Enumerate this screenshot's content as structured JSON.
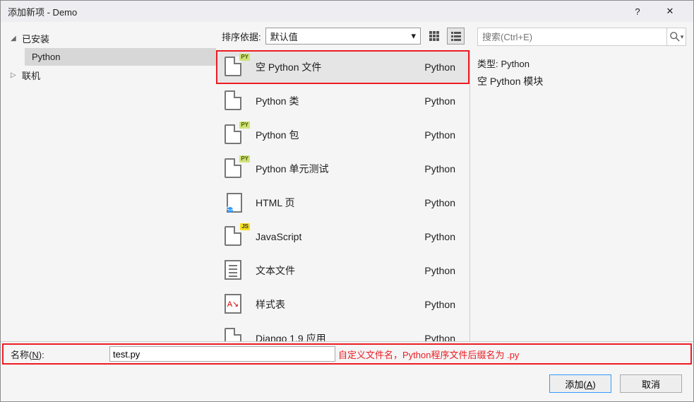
{
  "window": {
    "title": "添加新项 - Demo",
    "help": "?",
    "close": "✕"
  },
  "sidebar": {
    "installed": {
      "label": "已安装",
      "expanded": true,
      "children": [
        {
          "label": "Python",
          "selected": true
        }
      ]
    },
    "online": {
      "label": "联机",
      "expanded": false
    }
  },
  "sort": {
    "label": "排序依据:",
    "value": "默认值"
  },
  "search": {
    "placeholder": "搜索(Ctrl+E)"
  },
  "items": [
    {
      "label": "空 Python 文件",
      "lang": "Python",
      "icon": "py",
      "selected": true
    },
    {
      "label": "Python 类",
      "lang": "Python",
      "icon": "doc"
    },
    {
      "label": "Python 包",
      "lang": "Python",
      "icon": "py"
    },
    {
      "label": "Python 单元测试",
      "lang": "Python",
      "icon": "py"
    },
    {
      "label": "HTML 页",
      "lang": "Python",
      "icon": "html"
    },
    {
      "label": "JavaScript",
      "lang": "Python",
      "icon": "js"
    },
    {
      "label": "文本文件",
      "lang": "Python",
      "icon": "txt"
    },
    {
      "label": "样式表",
      "lang": "Python",
      "icon": "css"
    },
    {
      "label": "Django 1.9 应用",
      "lang": "Python",
      "icon": "doc"
    }
  ],
  "detail": {
    "type_label": "类型:",
    "type_value": "Python",
    "desc": "空 Python 模块"
  },
  "name": {
    "label": "名称(N):",
    "value": "test.py",
    "hint": "自定义文件名，Python程序文件后缀名为 .py"
  },
  "buttons": {
    "add": "添加(A)",
    "cancel": "取消"
  }
}
